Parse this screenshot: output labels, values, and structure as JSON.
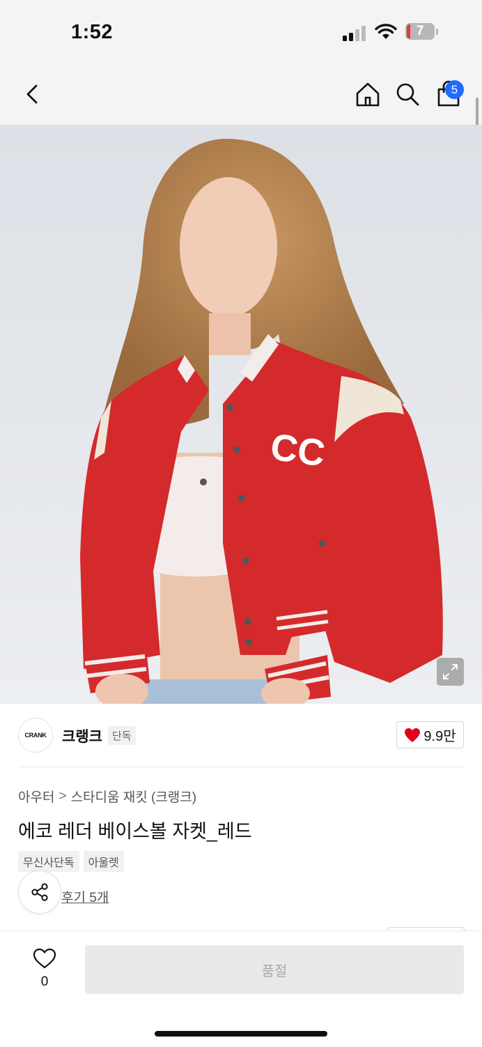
{
  "status_bar": {
    "time": "1:52",
    "battery": "7"
  },
  "nav": {
    "cart_count": "5"
  },
  "brand": {
    "logo_text": "CRANK",
    "name": "크랭크",
    "badge": "단독",
    "likes": "9.9만"
  },
  "breadcrumb": {
    "category": "아우터",
    "separator": ">",
    "subcategory": "스타디움 재킷 (크랭크)"
  },
  "product": {
    "title": "에코 레더 베이스볼 자켓_레드",
    "tags": [
      "무신사단독",
      "아울렛"
    ],
    "review_link": "후기 5개"
  },
  "bottom_bar": {
    "wish_count": "0",
    "buy_label": "품절"
  },
  "colors": {
    "accent_blue": "#1e6bff",
    "heart_red": "#e0001b",
    "jacket_red": "#d42a2c"
  }
}
